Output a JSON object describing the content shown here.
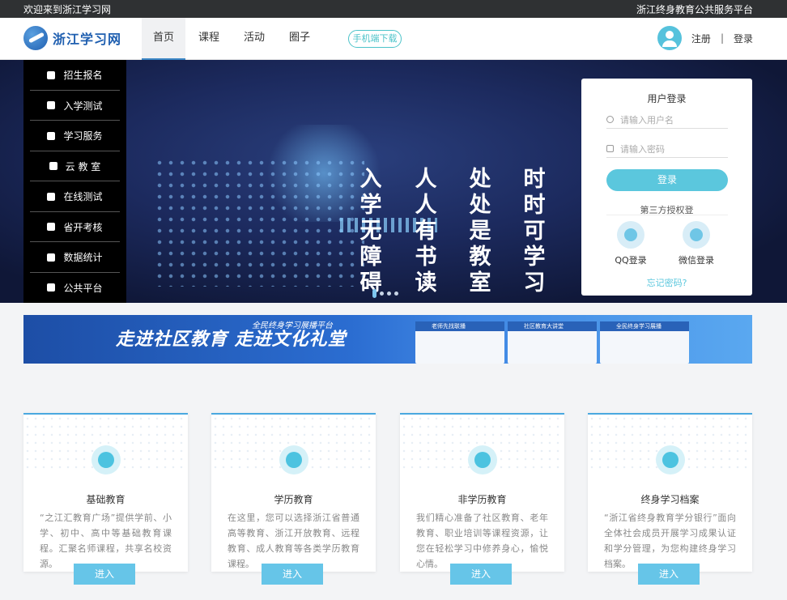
{
  "topbar": {
    "welcome": "欢迎来到浙江学习网",
    "platform": "浙江终身教育公共服务平台"
  },
  "header": {
    "logo_text": "浙江学习网",
    "nav": [
      {
        "label": "首页",
        "active": true
      },
      {
        "label": "课程"
      },
      {
        "label": "活动"
      },
      {
        "label": "圈子"
      }
    ],
    "app_download": "手机端下载",
    "register": "注册",
    "separator": "|",
    "login": "登录"
  },
  "sidebar": {
    "items": [
      {
        "label": "招生报名",
        "icon": "user-icon"
      },
      {
        "label": "入学测试",
        "icon": "cap-icon"
      },
      {
        "label": "学习服务",
        "icon": "image-icon"
      },
      {
        "label": "云 教 室",
        "icon": "cloud-icon"
      },
      {
        "label": "在线测试",
        "icon": "pen-icon"
      },
      {
        "label": "省开考核",
        "icon": "book-icon"
      },
      {
        "label": "数据统计",
        "icon": "chart-icon"
      },
      {
        "label": "公共平台",
        "icon": "platform-icon"
      }
    ]
  },
  "banner": {
    "columns": [
      "入学无障碍",
      "人人有书读",
      "处处是教室",
      "时时可学习"
    ],
    "slider_total": 4,
    "slider_active": 1
  },
  "login_card": {
    "title": "用户登录",
    "username_placeholder": "请输入用户名",
    "password_placeholder": "请输入密码",
    "button": "登录",
    "third_party_title": "第三方授权登",
    "oauth": [
      {
        "label": "QQ登录",
        "icon": "qq-icon"
      },
      {
        "label": "微信登录",
        "icon": "wechat-icon"
      }
    ],
    "forgot": "忘记密码?"
  },
  "promo": {
    "subtitle": "全民终身学习展播平台",
    "main": "走进社区教育  走进文化礼堂",
    "screens": [
      "老师先找联播",
      "社区教育大讲堂",
      "全民终身学习展播"
    ]
  },
  "cards": [
    {
      "title": "基础教育",
      "icon": "books-icon",
      "desc": "“之江汇教育广场”提供学前、小学、初中、高中等基础教育课程。汇聚名师课程，共享名校资源。",
      "button": "进入"
    },
    {
      "title": "学历教育",
      "icon": "graduation-cap-icon",
      "desc": "在这里，您可以选择浙江省普通高等教育、浙江开放教育、远程教育、成人教育等各类学历教育课程。",
      "button": "进入"
    },
    {
      "title": "非学历教育",
      "icon": "picture-icon",
      "desc": "我们精心准备了社区教育、老年教育、职业培训等课程资源，让您在轻松学习中修养身心，愉悦心情。",
      "button": "进入"
    },
    {
      "title": "终身学习档案",
      "icon": "folder-icon",
      "desc": "“浙江省终身教育学分银行”面向全体社会成员开展学习成果认证和学分管理，为您构建终身学习档案。",
      "button": "进入"
    }
  ]
}
